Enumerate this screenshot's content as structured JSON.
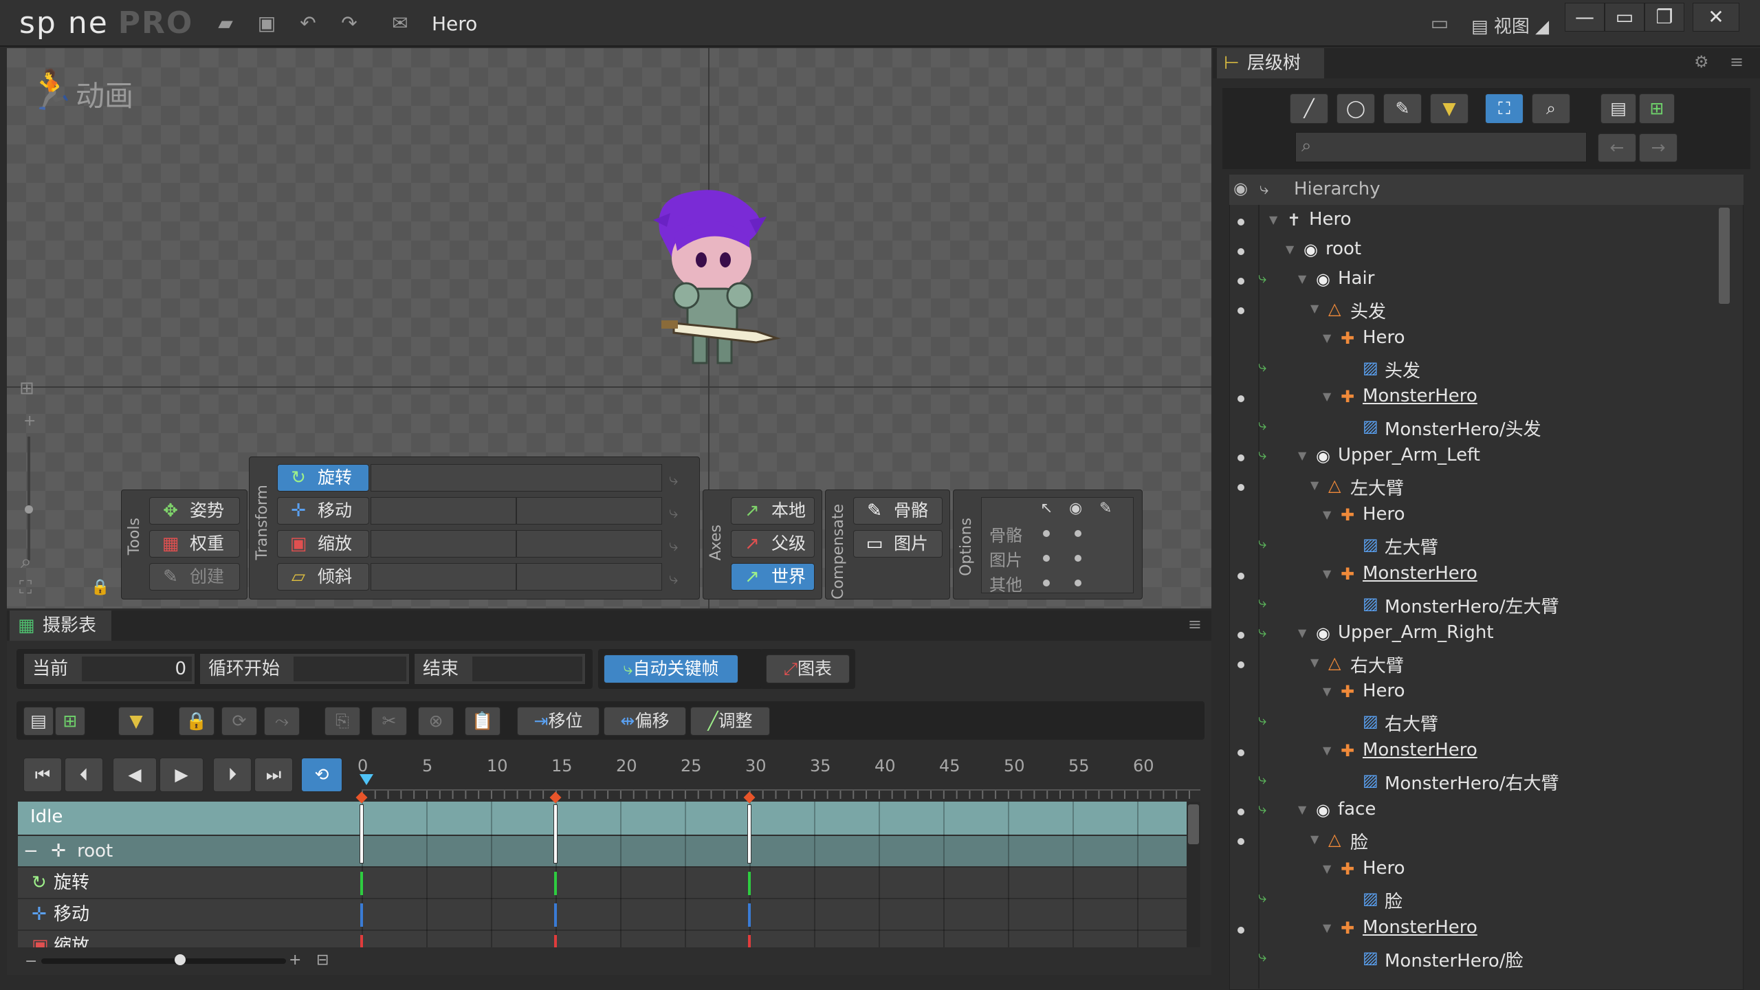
{
  "app": {
    "logo": "sp ne",
    "edition": "PRO",
    "document": "Hero",
    "view_menu": "视图"
  },
  "viewport": {
    "mode_title": "动画"
  },
  "tools": {
    "group_label": "Tools",
    "pose": "姿势",
    "weights": "权重",
    "create": "创建"
  },
  "transform": {
    "group_label": "Transform",
    "rotate": "旋转",
    "translate": "移动",
    "scale": "缩放",
    "shear": "倾斜"
  },
  "axes": {
    "group_label": "Axes",
    "local": "本地",
    "parent": "父级",
    "world": "世界"
  },
  "compensate": {
    "group_label": "Compensate",
    "bones": "骨骼",
    "images": "图片"
  },
  "options": {
    "group_label": "Options",
    "rows": [
      "骨骼",
      "图片",
      "其他"
    ]
  },
  "dopesheet": {
    "tab": "摄影表",
    "current_label": "当前",
    "current_value": "0",
    "loop_start_label": "循环开始",
    "end_label": "结束",
    "autokey": "自动关键帧",
    "graph": "图表",
    "offset": "移位",
    "shift": "偏移",
    "adjust": "调整",
    "ticks": [
      "0",
      "5",
      "10",
      "15",
      "20",
      "25",
      "30",
      "35",
      "40",
      "45",
      "50",
      "55",
      "60"
    ],
    "rows": [
      {
        "label": "Idle"
      },
      {
        "label": "root"
      },
      {
        "label": "旋转"
      },
      {
        "label": "移动"
      },
      {
        "label": "缩放"
      }
    ]
  },
  "tree": {
    "tab": "层级树",
    "column": "Hierarchy",
    "items": [
      {
        "label": "Hero"
      },
      {
        "label": "root"
      },
      {
        "label": "Hair"
      },
      {
        "label": "头发"
      },
      {
        "label": "Hero"
      },
      {
        "label": "头发"
      },
      {
        "label": "MonsterHero"
      },
      {
        "label": "MonsterHero/头发"
      },
      {
        "label": "Upper_Arm_Left"
      },
      {
        "label": "左大臂"
      },
      {
        "label": "Hero"
      },
      {
        "label": "左大臂"
      },
      {
        "label": "MonsterHero"
      },
      {
        "label": "MonsterHero/左大臂"
      },
      {
        "label": "Upper_Arm_Right"
      },
      {
        "label": "右大臂"
      },
      {
        "label": "Hero"
      },
      {
        "label": "右大臂"
      },
      {
        "label": "MonsterHero"
      },
      {
        "label": "MonsterHero/右大臂"
      },
      {
        "label": "face"
      },
      {
        "label": "脸"
      },
      {
        "label": "Hero"
      },
      {
        "label": "脸"
      },
      {
        "label": "MonsterHero"
      },
      {
        "label": "MonsterHero/脸"
      }
    ]
  },
  "colors": {
    "accent": "#3f86c6",
    "key_rotate": "#2ecc40",
    "key_translate": "#3a7bd5",
    "key_scale": "#e03c3c",
    "marker": "#e8552a",
    "playhead": "#4fc3f7"
  }
}
